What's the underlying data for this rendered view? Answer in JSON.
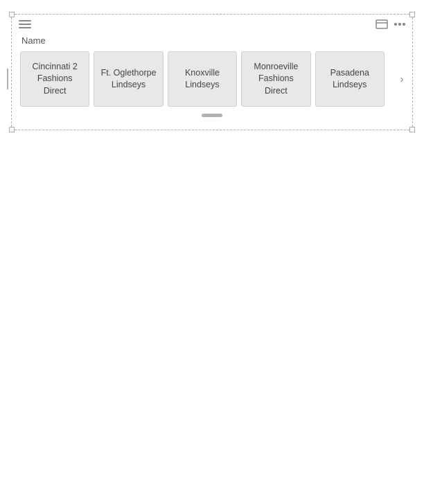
{
  "toolbar": {
    "hamburger_label": "menu",
    "expand_label": "expand",
    "more_label": "more options"
  },
  "header": {
    "column_name": "Name"
  },
  "cards": [
    {
      "id": 1,
      "label": "Cincinnati 2 Fashions Direct"
    },
    {
      "id": 2,
      "label": "Ft. Oglethorpe Lindseys"
    },
    {
      "id": 3,
      "label": "Knoxville Lindseys"
    },
    {
      "id": 4,
      "label": "Monroeville Fashions Direct"
    },
    {
      "id": 5,
      "label": "Pasadena Lindseys"
    }
  ],
  "nav": {
    "next_arrow": "›"
  }
}
